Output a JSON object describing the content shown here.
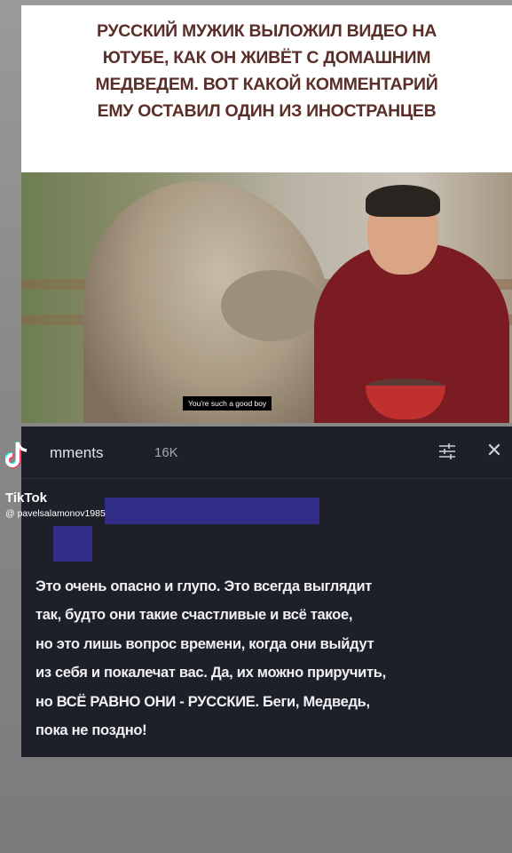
{
  "headline": {
    "lines": [
      "РУССКИЙ МУЖИК ВЫЛОЖИЛ ВИДЕО НА",
      "ЮТУБЕ, КАК ОН ЖИВЁТ С ДОМАШНИМ",
      "МЕДВЕДЕМ. ВОТ КАКОЙ КОММЕНТАРИЙ",
      "ЕМУ ОСТАВИЛ ОДИН ИЗ ИНОСТРАНЦЕВ"
    ]
  },
  "photo": {
    "caption": "You're such a good boy"
  },
  "comments_panel": {
    "title": "mments",
    "count": "16K",
    "comment_lines": [
      "Это очень опасно и глупо. Это всегда выглядит",
      "так, будто они такие счастливые и всё такое,",
      "но это лишь вопрос времени, когда они выйдут",
      "из себя и покалечат вас. Да, их можно приручить,",
      "но ВСЁ РАВНО ОНИ - РУССКИЕ. Беги, Медведь,",
      "пока не поздно!"
    ]
  },
  "watermark": {
    "brand": "TikTok",
    "user": "@ pavelsalamonov1985"
  },
  "colors": {
    "headline": "#5a2f2a",
    "panel_bg": "#1d2029",
    "redaction": "#312c86"
  }
}
